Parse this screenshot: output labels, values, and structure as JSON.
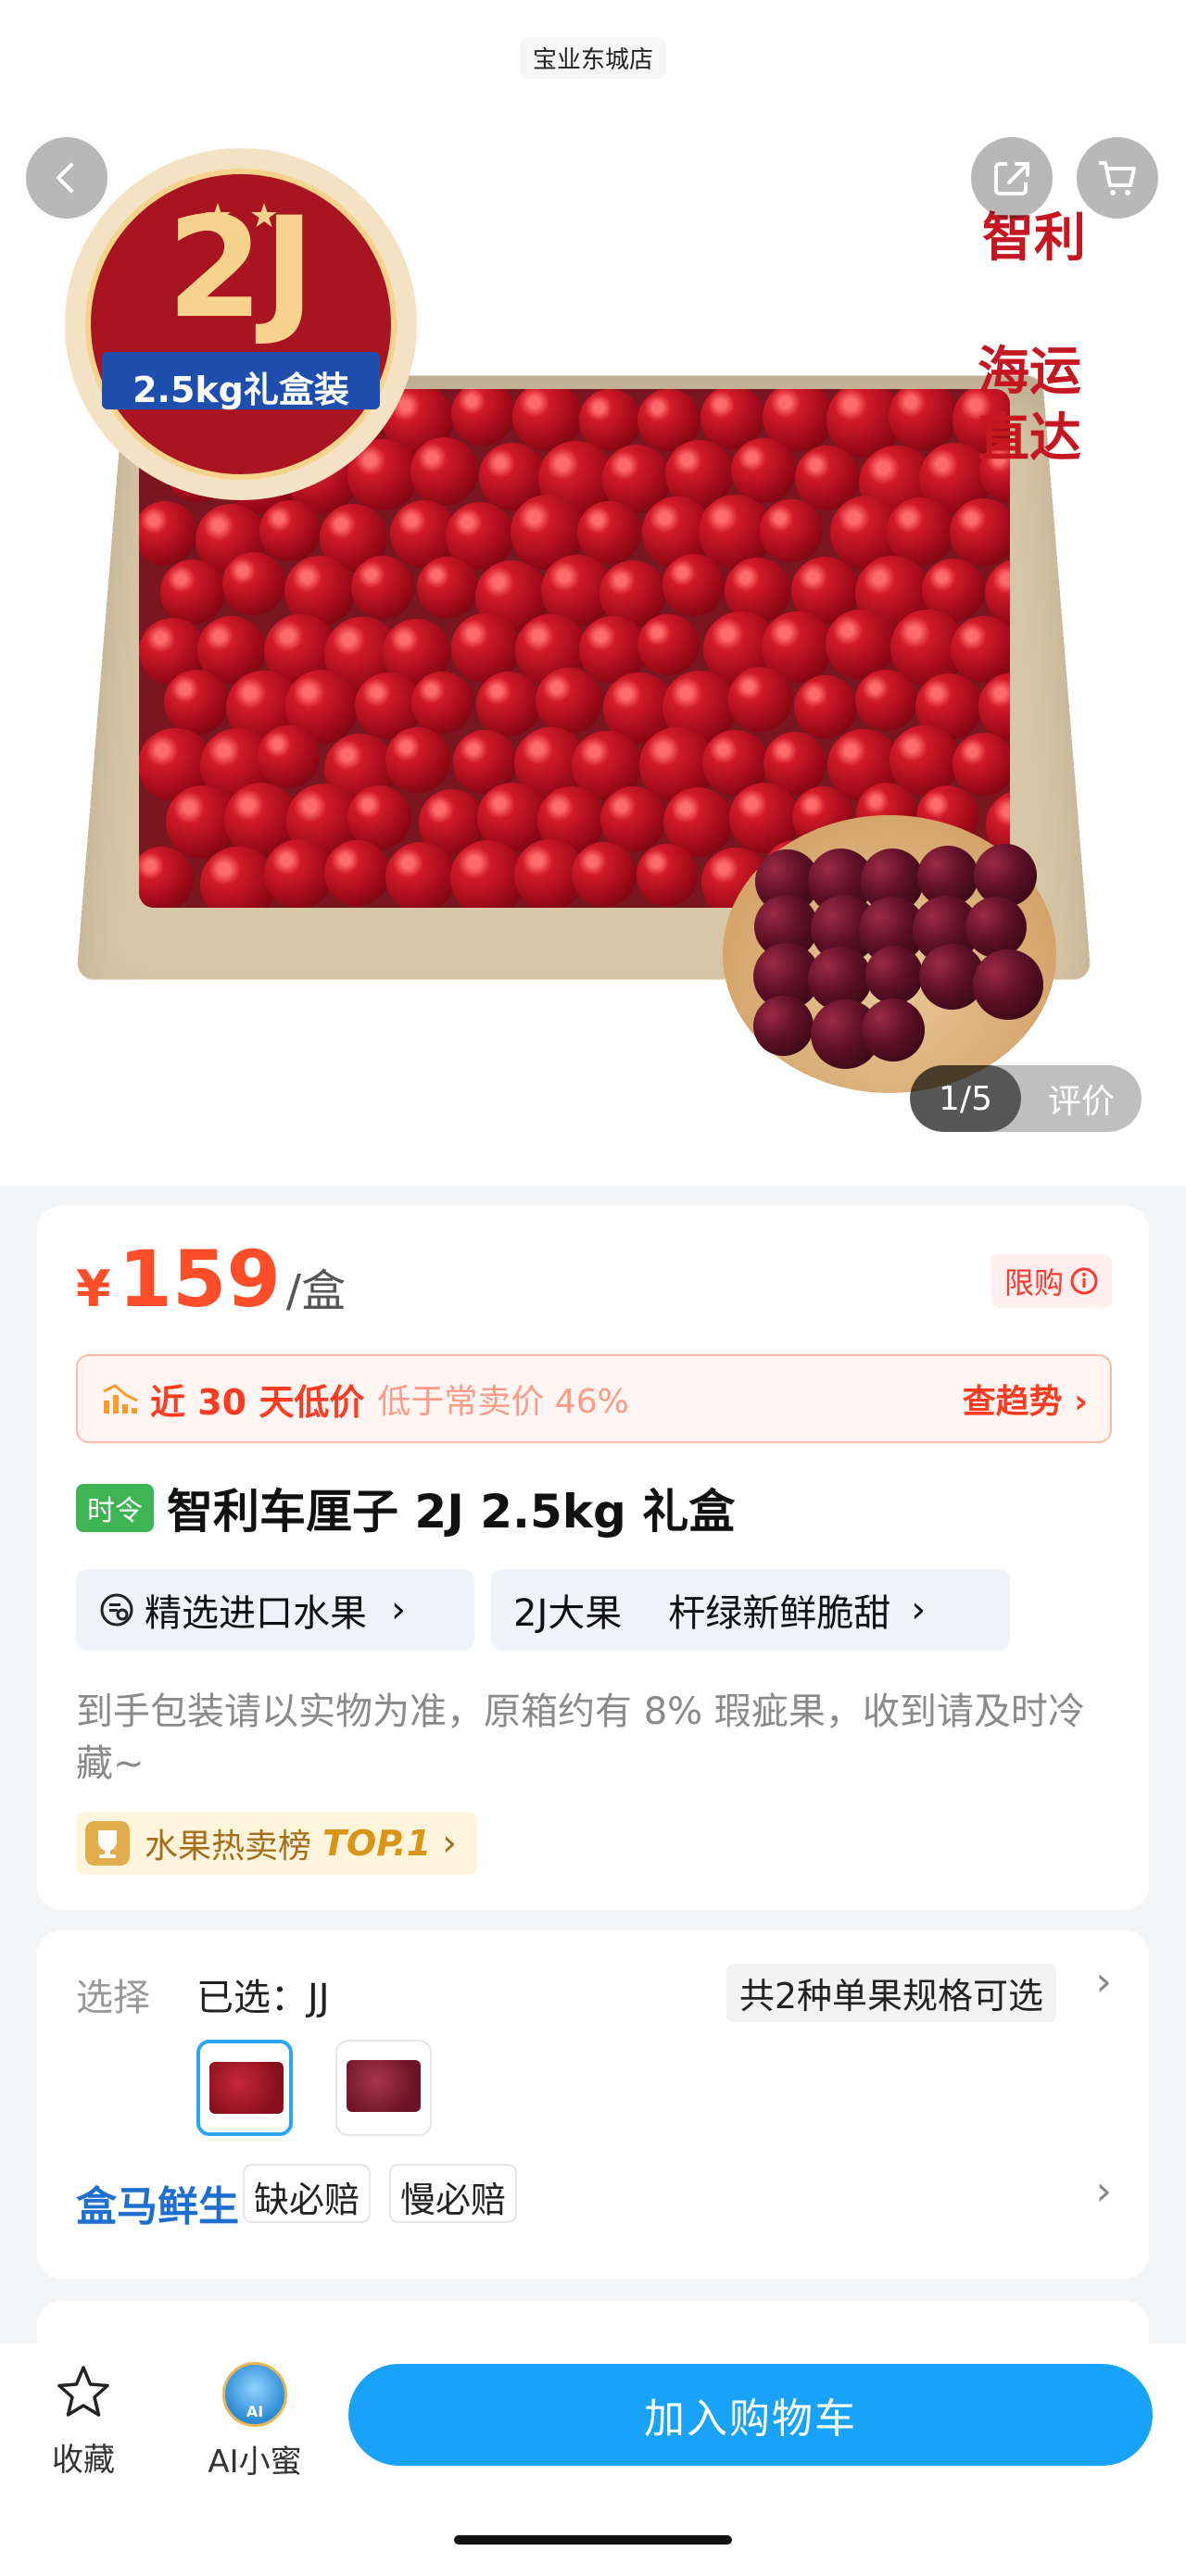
{
  "store": {
    "name": "宝业东城店"
  },
  "hero": {
    "badge_grade": "2J",
    "badge_sub": "2.5kg礼盒装",
    "side_text_1": "智利",
    "side_text_2a": "海运",
    "side_text_2b": "直达",
    "pager": "1/5",
    "review_label": "评价"
  },
  "price": {
    "symbol": "¥",
    "amount": "159",
    "unit": "/盒",
    "limit_label": "限购"
  },
  "low_price": {
    "title": "近 30 天低价",
    "subtitle": "低于常卖价 46%",
    "trend_label": "查趋势"
  },
  "product": {
    "season_tag": "时令",
    "title": "智利车厘子 2J 2.5kg 礼盒",
    "tag_category": "精选进口水果",
    "tag_feature_1": "2J大果",
    "tag_feature_2": "杆绿新鲜脆甜",
    "description": "到手包装请以实物为准，原箱约有 8% 瑕疵果，收到请及时冷藏~",
    "rank_label": "水果热卖榜",
    "rank_value": "TOP.1"
  },
  "spec": {
    "select_label": "选择",
    "selected_prefix": "已选：JJ",
    "spec_count": "共2种单果规格可选",
    "brand": "盒马鲜生",
    "promise_1": "缺必赔",
    "promise_2": "慢必赔"
  },
  "bottom": {
    "favorite_label": "收藏",
    "ai_label": "AI小蜜",
    "ai_badge": "AI",
    "add_to_cart": "加入购物车"
  },
  "colors": {
    "accent_price": "#ff4d2a",
    "primary_button": "#19a3f8",
    "brand_blue": "#1e6fd0",
    "season_green": "#3fb454"
  }
}
